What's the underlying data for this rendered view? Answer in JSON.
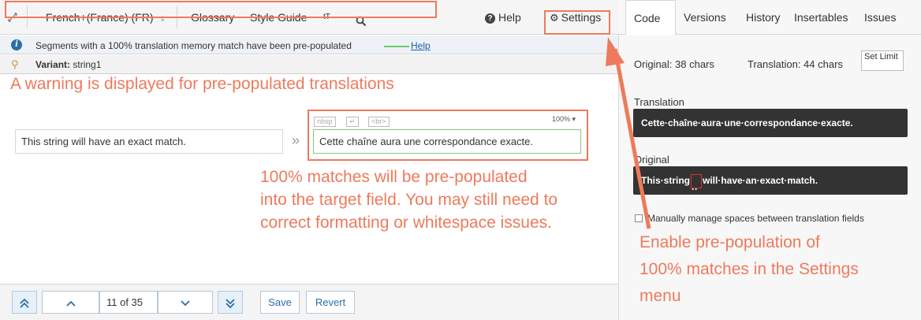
{
  "toolbar": {
    "language": "French+(France) (FR)",
    "glossary": "Glossary",
    "style_guide": "Style Guide",
    "text_size_icon": "tT",
    "help": "Help",
    "settings": "Settings"
  },
  "notice": {
    "text": "Segments with a 100% translation memory match have been pre-populated",
    "link": "Help"
  },
  "variant": {
    "label": "Variant:",
    "value": "string1"
  },
  "annotations": {
    "warning": "A warning is displayed for pre-populated translations",
    "matches_line1": "100% matches will be pre-populated",
    "matches_line2": "into the target field. You may still need to",
    "matches_line3": "correct formatting or whitespace issues.",
    "enable_line1": "Enable pre-population of",
    "enable_line2": "100% matches in the Settings",
    "enable_line3": "menu"
  },
  "segment": {
    "source": "This string will have an exact match.",
    "target": "Cette chaîne aura une correspondance exacte.",
    "chips": [
      "nbsp",
      "↵",
      "<br>"
    ],
    "match_percent": "100%"
  },
  "nav": {
    "page": "11 of 35",
    "save": "Save",
    "revert": "Revert"
  },
  "panel": {
    "tabs": [
      "Code",
      "Versions",
      "History",
      "Insertables",
      "Issues"
    ],
    "original_count": "Original: 38 chars",
    "translation_count": "Translation: 44 chars",
    "set_limit": "Set Limit",
    "translation_label": "Translation",
    "translation_text": "Cette·chaîne·aura·une·correspondance·exacte.",
    "original_label": "Original",
    "original_text_before": "This·string",
    "original_text_marked": "··",
    "original_text_after": "will·have·an·exact·match.",
    "checkbox_label": "Manually manage spaces between translation fields"
  },
  "colors": {
    "annotation": "#ee7a5c",
    "link": "#1a5fb4",
    "accent_blue": "#2c6ea5",
    "match_green": "#66cc66"
  }
}
